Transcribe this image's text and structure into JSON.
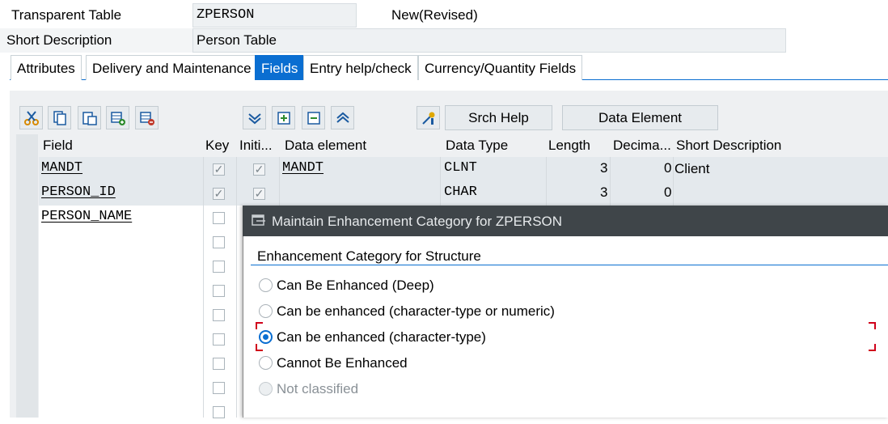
{
  "header": {
    "table_type_label": "Transparent Table",
    "table_name": "ZPERSON",
    "status": "New(Revised)",
    "short_desc_label": "Short Description",
    "short_desc_value": "Person Table"
  },
  "tabs": [
    {
      "label": "Attributes",
      "active": false
    },
    {
      "label": "Delivery and Maintenance",
      "active": false
    },
    {
      "label": "Fields",
      "active": true
    },
    {
      "label": "Entry help/check",
      "active": false
    },
    {
      "label": "Currency/Quantity Fields",
      "active": false
    }
  ],
  "toolbar": {
    "icons": [
      "cut-icon",
      "copy-icon",
      "paste-icon",
      "insert-row-icon",
      "delete-row-icon",
      "filter-down-icon",
      "expand-icon",
      "collapse-icon",
      "filter-up-icon",
      "predefined-type-icon"
    ],
    "srch_help_label": "Srch Help",
    "data_element_label": "Data Element"
  },
  "table": {
    "columns": [
      "Field",
      "Key",
      "Initi...",
      "Data element",
      "Data Type",
      "Length",
      "Decima...",
      "Short Description"
    ],
    "rows": [
      {
        "field": "MANDT",
        "key": true,
        "initial": true,
        "data_element": "MANDT",
        "data_type": "CLNT",
        "length": "3",
        "decimals": "0",
        "short_description": "Client"
      },
      {
        "field": "PERSON_ID",
        "key": true,
        "initial": true,
        "data_element": "",
        "data_type": "CHAR",
        "length": "3",
        "decimals": "0",
        "short_description": ""
      },
      {
        "field": "PERSON_NAME",
        "key": false,
        "initial": false,
        "data_element": "",
        "data_type": "",
        "length": "",
        "decimals": "",
        "short_description": ""
      }
    ]
  },
  "dialog": {
    "title": "Maintain Enhancement Category for ZPERSON",
    "section_title": "Enhancement Category for Structure",
    "options": [
      {
        "label": "Can Be Enhanced (Deep)",
        "selected": false,
        "disabled": false
      },
      {
        "label": "Can be enhanced (character-type or numeric)",
        "selected": false,
        "disabled": false
      },
      {
        "label": "Can be enhanced (character-type)",
        "selected": true,
        "disabled": false
      },
      {
        "label": "Cannot Be Enhanced",
        "selected": false,
        "disabled": false
      },
      {
        "label": "Not classified",
        "selected": false,
        "disabled": true
      }
    ]
  },
  "colors": {
    "accent": "#0a6ed1",
    "dialog_title_bar": "#3f4549",
    "focus_corner": "#d0021b"
  }
}
